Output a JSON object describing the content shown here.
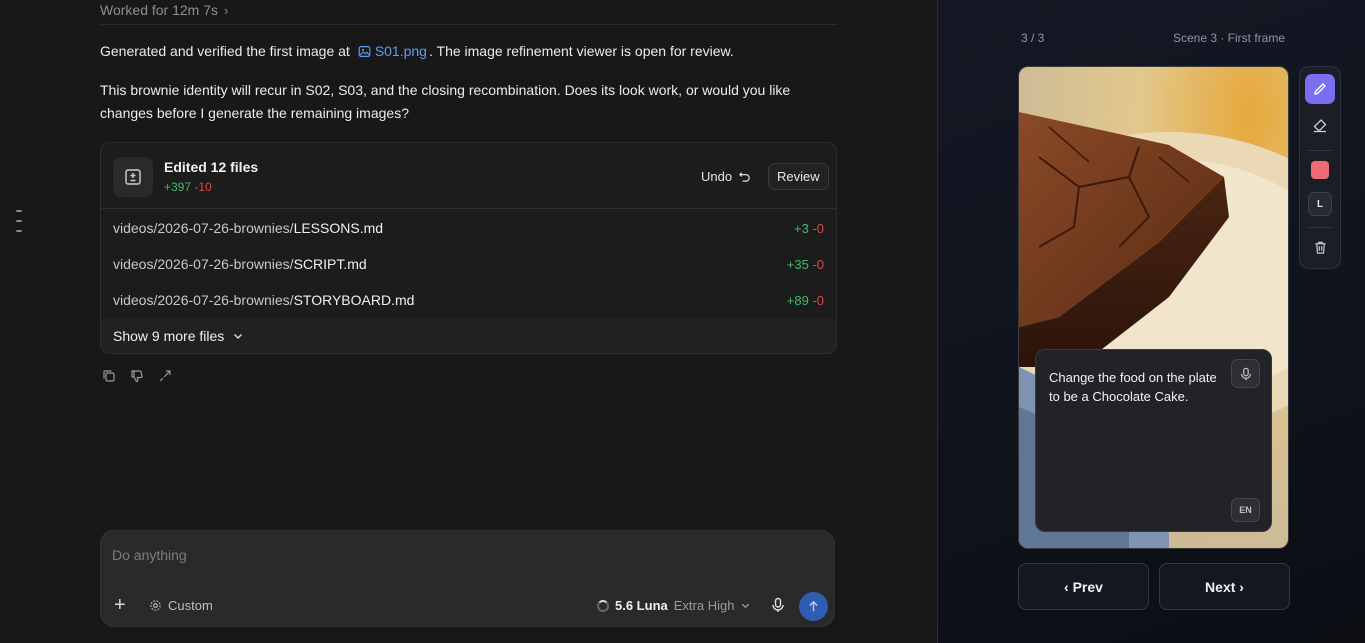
{
  "chat": {
    "worked_label": "Worked for 12m 7s",
    "message1_pre": "Generated and verified the first image at",
    "message1_file": "S01.png",
    "message1_post": ". The image refinement viewer is open for review.",
    "message2": "This brownie identity will recur in S02, S03, and the closing recombination. Does its look work, or would you like changes before I generate the remaining images?",
    "edits": {
      "title": "Edited 12 files",
      "added": "+397",
      "removed": "-10",
      "undo_label": "Undo",
      "review_label": "Review",
      "files": [
        {
          "dir": "videos/2026-07-26-brownies/",
          "name": "LESSONS.md",
          "added": "+3",
          "removed": "-0"
        },
        {
          "dir": "videos/2026-07-26-brownies/",
          "name": "SCRIPT.md",
          "added": "+35",
          "removed": "-0"
        },
        {
          "dir": "videos/2026-07-26-brownies/",
          "name": "STORYBOARD.md",
          "added": "+89",
          "removed": "-0"
        }
      ],
      "show_more_label": "Show 9 more files"
    },
    "actions": [
      "copy-icon",
      "thumbs-down-icon",
      "share-icon"
    ]
  },
  "composer": {
    "placeholder": "Do anything",
    "custom_label": "Custom",
    "model_name": "5.6 Luna",
    "model_effort": "Extra High"
  },
  "viewer": {
    "counter": "3 / 3",
    "scene_label": "Scene 3 · First frame",
    "prompt_text": "Change the food on the plate to be a Chocolate Cake.",
    "language": "EN",
    "size_label": "L",
    "brush_color": "#ef6b76",
    "accent_color": "#7a6ff0",
    "prev_label": "‹ Prev",
    "next_label": "Next ›"
  }
}
